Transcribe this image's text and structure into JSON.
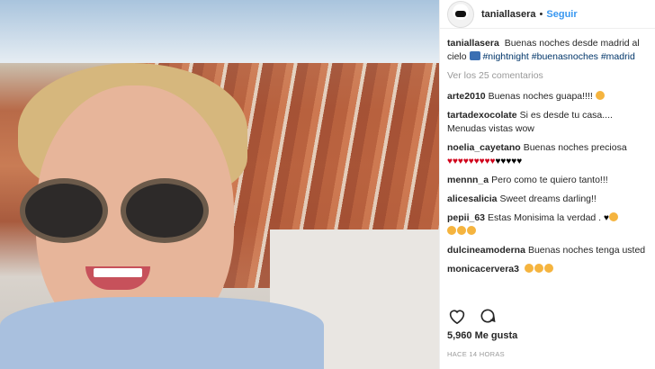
{
  "post": {
    "username": "taniallasera",
    "separator": "•",
    "follow_label": "Seguir",
    "caption_user": "taniallasera",
    "caption_text": "Buenas noches desde madrid al cielo",
    "caption_tags": [
      "#nightnight",
      "#buenasnoches",
      "#madrid"
    ],
    "view_comments": "Ver los 25 comentarios",
    "likes": "5,960 Me gusta",
    "time": "HACE 14 HORAS"
  },
  "comments": [
    {
      "user": "arte2010",
      "text": "Buenas noches guapa!!!!"
    },
    {
      "user": "tartadexocolate",
      "text": "Si es desde tu casa.... Menudas vistas wow"
    },
    {
      "user": "noelia_cayetano",
      "text": "Buenas noches preciosa"
    },
    {
      "user": "mennn_a",
      "text": "Pero como te quiero tanto!!!"
    },
    {
      "user": "alicesalicia",
      "text": "Sweet dreams darling!!"
    },
    {
      "user": "pepii_63",
      "text": "Estas Monisima la verdad ."
    },
    {
      "user": "dulcineamoderna",
      "text": "Buenas noches tenga usted"
    },
    {
      "user": "monicacervera3",
      "text": ""
    }
  ],
  "icons": {
    "like": "heart-outline-icon",
    "comment": "speech-bubble-icon",
    "avatar": "avatar-image"
  },
  "colors": {
    "link": "#3897f0",
    "tag": "#003569",
    "muted": "#999999",
    "text": "#262626"
  }
}
